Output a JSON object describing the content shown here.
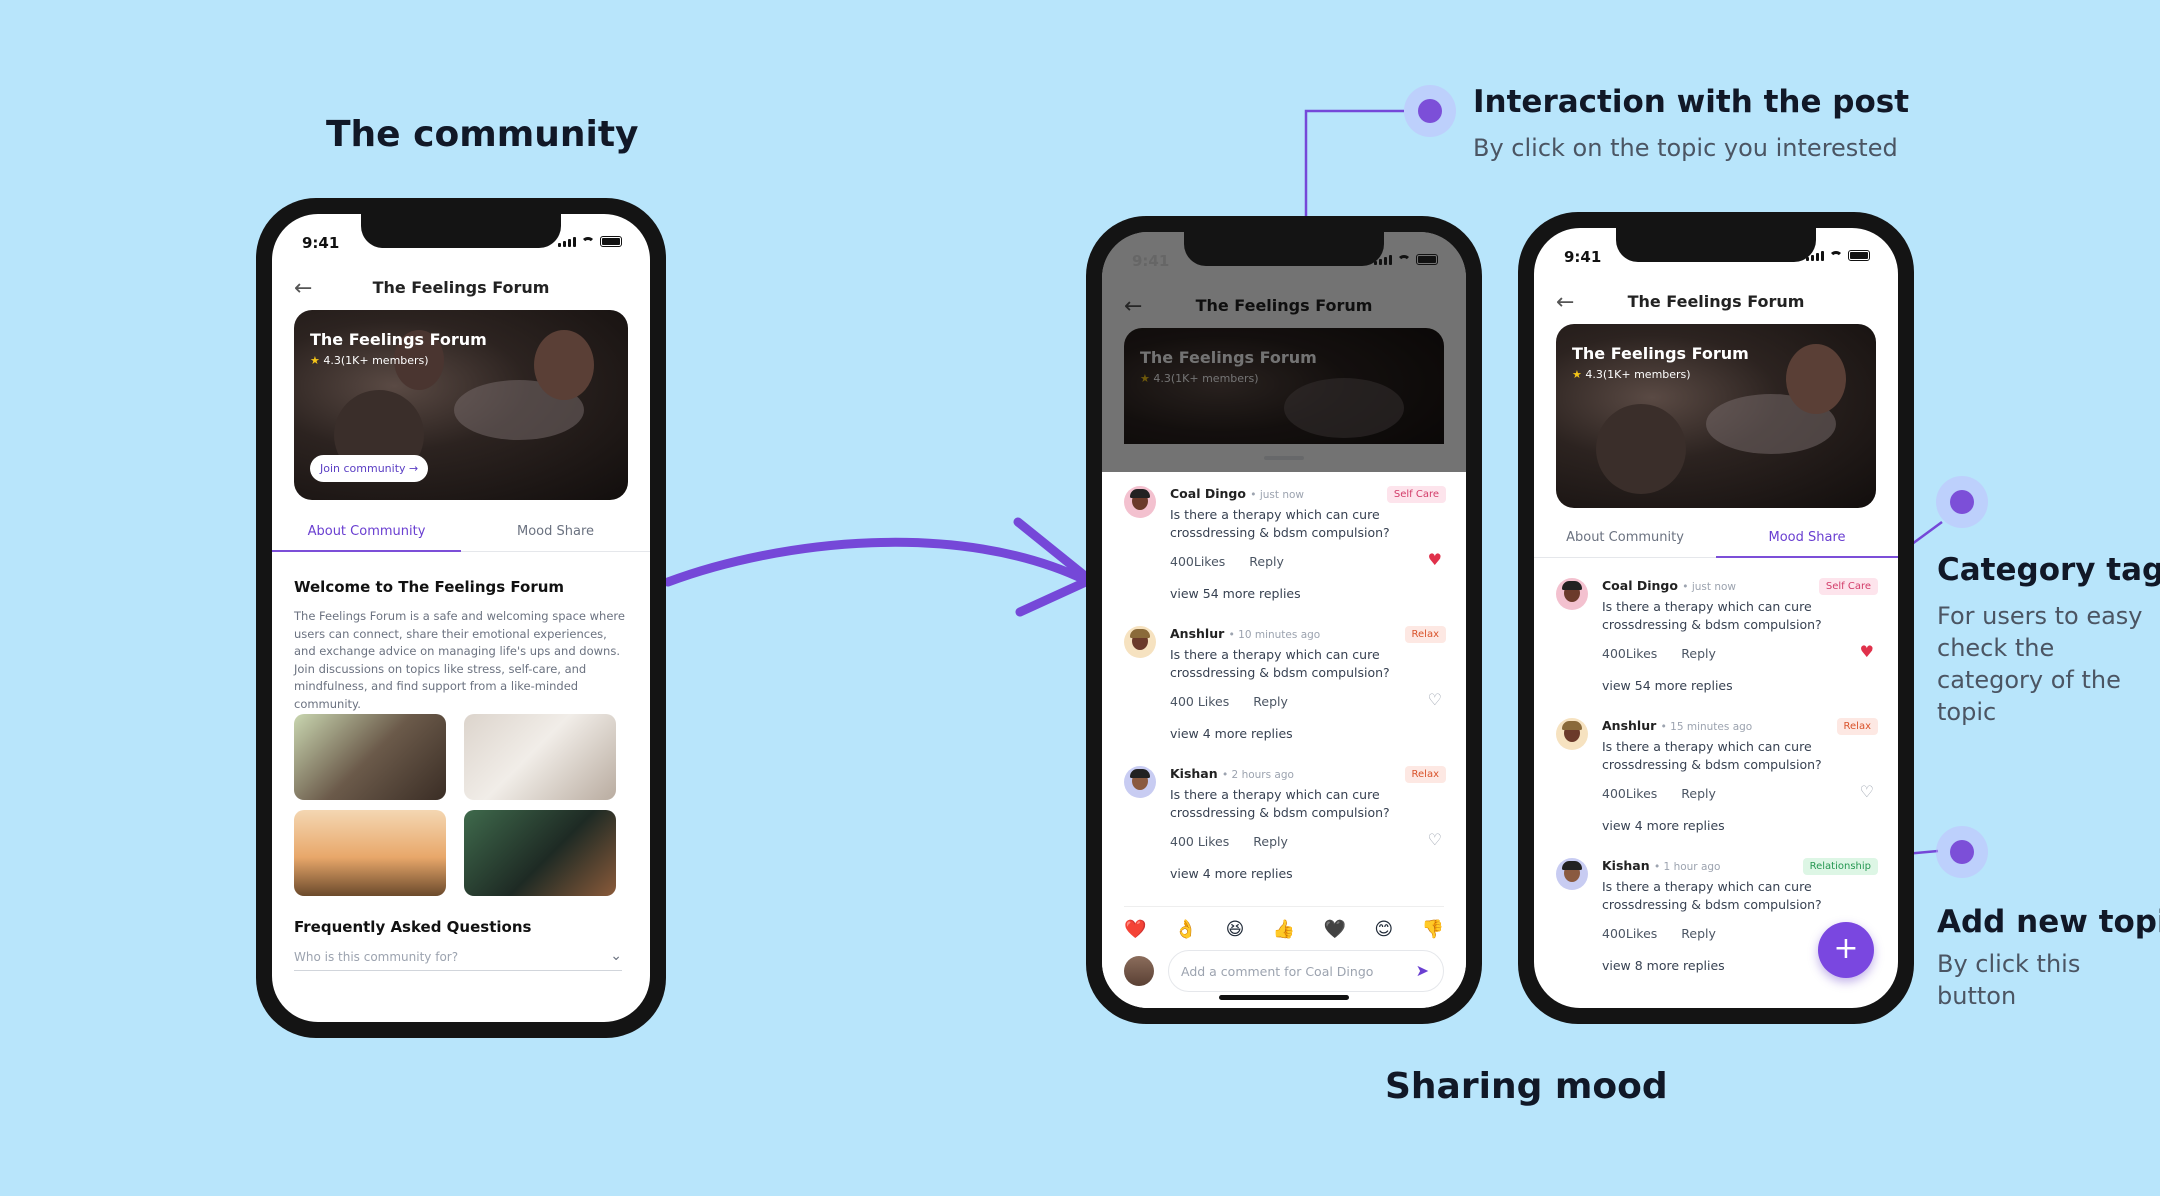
{
  "headings": {
    "community": "The community",
    "sharing": "Sharing mood"
  },
  "annotations": {
    "interaction": {
      "title": "Interaction with the post",
      "subtitle": "By click on the topic you interested"
    },
    "category": {
      "title": "Category tag",
      "line1": "For users to easy",
      "line2": "check the",
      "line3": "category of the",
      "line4": "topic"
    },
    "add_topic": {
      "title": "Add new topic",
      "line1": "By click this",
      "line2": "button"
    }
  },
  "status": {
    "time": "9:41"
  },
  "app": {
    "header_title": "The Feelings Forum",
    "hero": {
      "title": "The Feelings Forum",
      "rating": "4.3(1K+ members)",
      "join_label": "Join community →"
    },
    "tabs": [
      "About Community",
      "Mood Share"
    ],
    "about": {
      "title": "Welcome to The Feelings Forum",
      "description": "The Feelings Forum is a safe and welcoming space where users can connect, share their emotional experiences, and exchange advice on managing life's ups and downs. Join discussions on topics like stress, self-care, and mindfulness, and find support from a like-minded community.",
      "faq_title": "Frequently Asked Questions",
      "faq_question": "Who is this community for?"
    }
  },
  "comments_sheet": [
    {
      "name": "Coal Dingo",
      "time": "just now",
      "tag": "Self Care",
      "text": "Is there a therapy which can cure crossdressing & bdsm compulsion?",
      "likes": "400Likes",
      "reply": "Reply",
      "more": "view 54 more replies"
    },
    {
      "name": "Anshlur",
      "time": "10 minutes ago",
      "tag": "Relax",
      "text": "Is there a therapy which can cure crossdressing & bdsm compulsion?",
      "likes": "400 Likes",
      "reply": "Reply",
      "more": "view 4 more replies"
    },
    {
      "name": "Kishan",
      "time": "2 hours ago",
      "tag": "Relax",
      "text": "Is there a therapy which can cure crossdressing & bdsm compulsion?",
      "likes": "400 Likes",
      "reply": "Reply",
      "more": "view 4 more replies"
    }
  ],
  "comments_feed": [
    {
      "name": "Coal Dingo",
      "time": "just now",
      "tag": "Self Care",
      "text": "Is there a therapy which can cure crossdressing & bdsm compulsion?",
      "likes": "400Likes",
      "reply": "Reply",
      "more": "view 54 more replies"
    },
    {
      "name": "Anshlur",
      "time": "15 minutes ago",
      "tag": "Relax",
      "text": "Is there a therapy which can cure crossdressing & bdsm compulsion?",
      "likes": "400Likes",
      "reply": "Reply",
      "more": "view 4 more replies"
    },
    {
      "name": "Kishan",
      "time": "1 hour ago",
      "tag": "Relationship",
      "text": "Is there a therapy which can cure crossdressing & bdsm compulsion?",
      "likes": "400Likes",
      "reply": "Reply",
      "more": "view 8 more replies"
    }
  ],
  "emojis": [
    "❤️",
    "👌",
    "😆",
    "👍",
    "🖤",
    "😊",
    "👎"
  ],
  "comment_input": {
    "placeholder": "Add a comment for Coal Dingo"
  },
  "colors": {
    "background": "#b8e5fb",
    "accent": "#7c4fd8"
  }
}
